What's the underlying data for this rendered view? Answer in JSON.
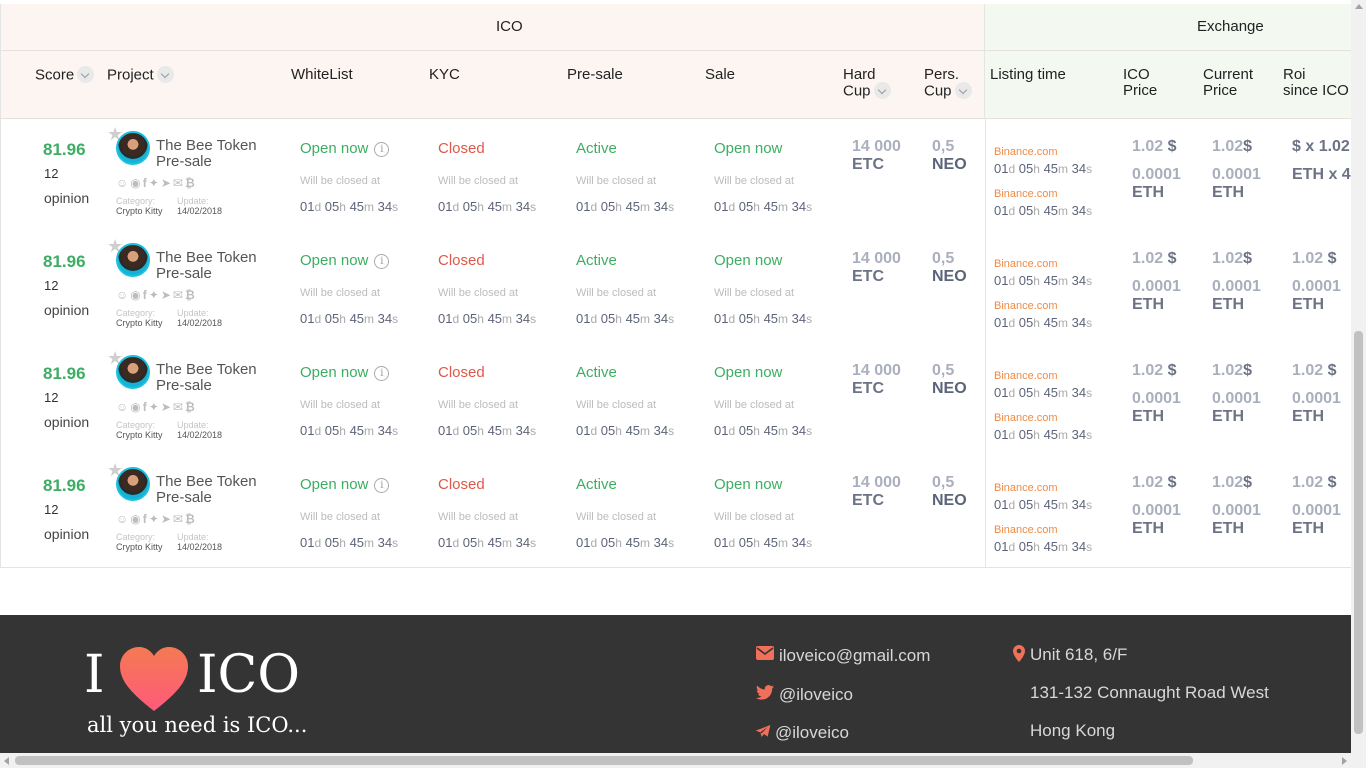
{
  "table": {
    "groups": {
      "ico": "ICO",
      "exchange": "Exchange"
    },
    "headers": {
      "score": "Score",
      "project": "Project",
      "whitelist": "WhiteList",
      "kyc": "KYC",
      "presale": "Pre-sale",
      "sale": "Sale",
      "hard_cup_1": "Hard",
      "hard_cup_2": "Cup",
      "pers_cup_1": "Pers.",
      "pers_cup_2": "Cup",
      "listing_time": "Listing time",
      "ico_price_1": "ICO",
      "ico_price_2": "Price",
      "current_price_1": "Current",
      "current_price_2": "Price",
      "roi_1": "Roi",
      "roi_2": "since ICO"
    },
    "rows": [
      {
        "score": "81.96",
        "opinions": "12",
        "opinion_label": "opinion",
        "project_name": "The Bee Token",
        "project_stage": "Pre-sale",
        "category_label": "Category:",
        "category": "Crypto Kitty",
        "update_label": "Update:",
        "update": "14/02/2018",
        "whitelist": "Open now",
        "kyc": "Closed",
        "presale": "Active",
        "sale": "Open now",
        "will_close": "Will be closed at",
        "hard_cup_value": "14 000",
        "hard_cup_unit": "ETC",
        "pers_cup_value": "0,5",
        "pers_cup_unit": "NEO",
        "listing_1": "Binance.com",
        "listing_2": "Binance.com",
        "ico_price_usd": "1.02",
        "ico_price_eth": "0.0001",
        "ico_price_eth_unit": "ETH",
        "current_price_usd": "1.02",
        "current_price_eth": "0.0001",
        "current_price_eth_unit": "ETH",
        "roi_usd": "$ x 1.02",
        "roi_eth": "ETH x 4"
      },
      {
        "score": "81.96",
        "opinions": "12",
        "opinion_label": "opinion",
        "project_name": "The Bee Token",
        "project_stage": "Pre-sale",
        "category_label": "Category:",
        "category": "Crypto Kitty",
        "update_label": "Update:",
        "update": "14/02/2018",
        "whitelist": "Open now",
        "kyc": "Closed",
        "presale": "Active",
        "sale": "Open now",
        "will_close": "Will be closed at",
        "hard_cup_value": "14 000",
        "hard_cup_unit": "ETC",
        "pers_cup_value": "0,5",
        "pers_cup_unit": "NEO",
        "listing_1": "Binance.com",
        "listing_2": "Binance.com",
        "ico_price_usd": "1.02",
        "ico_price_eth": "0.0001",
        "ico_price_eth_unit": "ETH",
        "current_price_usd": "1.02",
        "current_price_eth": "0.0001",
        "current_price_eth_unit": "ETH",
        "roi_usd": "1.02",
        "roi_eth": "0.0001",
        "roi_eth_unit": "ETH"
      },
      {
        "score": "81.96",
        "opinions": "12",
        "opinion_label": "opinion",
        "project_name": "The Bee Token",
        "project_stage": "Pre-sale",
        "category_label": "Category:",
        "category": "Crypto Kitty",
        "update_label": "Update:",
        "update": "14/02/2018",
        "whitelist": "Open now",
        "kyc": "Closed",
        "presale": "Active",
        "sale": "Open now",
        "will_close": "Will be closed at",
        "hard_cup_value": "14 000",
        "hard_cup_unit": "ETC",
        "pers_cup_value": "0,5",
        "pers_cup_unit": "NEO",
        "listing_1": "Binance.com",
        "listing_2": "Binance.com",
        "ico_price_usd": "1.02",
        "ico_price_eth": "0.0001",
        "ico_price_eth_unit": "ETH",
        "current_price_usd": "1.02",
        "current_price_eth": "0.0001",
        "current_price_eth_unit": "ETH",
        "roi_usd": "1.02",
        "roi_eth": "0.0001",
        "roi_eth_unit": "ETH"
      },
      {
        "score": "81.96",
        "opinions": "12",
        "opinion_label": "opinion",
        "project_name": "The Bee Token",
        "project_stage": "Pre-sale",
        "category_label": "Category:",
        "category": "Crypto Kitty",
        "update_label": "Update:",
        "update": "14/02/2018",
        "whitelist": "Open now",
        "kyc": "Closed",
        "presale": "Active",
        "sale": "Open now",
        "will_close": "Will be closed at",
        "hard_cup_value": "14 000",
        "hard_cup_unit": "ETC",
        "pers_cup_value": "0,5",
        "pers_cup_unit": "NEO",
        "listing_1": "Binance.com",
        "listing_2": "Binance.com",
        "ico_price_usd": "1.02",
        "ico_price_eth": "0.0001",
        "ico_price_eth_unit": "ETH",
        "current_price_usd": "1.02",
        "current_price_eth": "0.0001",
        "current_price_eth_unit": "ETH",
        "roi_usd": "1.02",
        "roi_eth": "0.0001",
        "roi_eth_unit": "ETH"
      }
    ],
    "timer": {
      "d": "01",
      "h": "05",
      "m": "45",
      "s": "34"
    },
    "timer_units": {
      "d": "d",
      "h": "h",
      "m": "m",
      "s": "s"
    },
    "currency_symbol": "$"
  },
  "footer": {
    "logo_left": "I",
    "logo_right": "ICO",
    "tagline": "all you need is ICO...",
    "email": "iloveico@gmail.com",
    "twitter": "@iloveico",
    "telegram": "@iloveico",
    "address_1": "Unit 618, 6/F",
    "address_2": "131-132 Connaught Road West",
    "address_3": "Hong Kong"
  },
  "icons": {
    "sort": "chevron-down-icon",
    "favorite": "star-icon",
    "info": "info-icon",
    "email": "envelope-icon",
    "twitter": "twitter-icon",
    "telegram": "telegram-icon",
    "location": "map-pin-icon",
    "logo_heart": "heart-icon"
  },
  "colors": {
    "accent_green": "#3cae63",
    "accent_red": "#e0584a",
    "accent_orange": "#f08a43",
    "ico_header_bg": "#fdf5f2",
    "exchange_header_bg": "#f3f8f1",
    "footer_bg": "#343434"
  }
}
